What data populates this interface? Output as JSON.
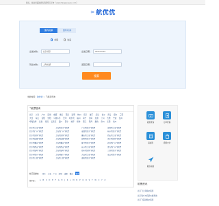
{
  "topbar": {
    "text": "您好，欢迎光临航优优机票预订平台（www.hangyouyou.com）"
  },
  "logo": {
    "text": "航优优"
  },
  "tabs": [
    {
      "label": "国内机票"
    },
    {
      "label": "国际机票"
    }
  ],
  "trip": {
    "oneway": "单程",
    "round": "往返"
  },
  "form": {
    "from_label": "出发城市：",
    "from_value": "北京/南京",
    "date_label": "出发日期：",
    "date_value": "2025-09-29",
    "to_label": "到达城市：",
    "to_value": "上海/虹桥",
    "return_label": "返回日期："
  },
  "search_button": "搜索",
  "breadcrumb": {
    "label": "当前位置：",
    "home": "航优优",
    "sep": ">",
    "current": "飞机票查询"
  },
  "main": {
    "title": "飞机票查询",
    "cities": [
      [
        "北京",
        "上海",
        "广州",
        "深圳",
        "成都",
        "重庆",
        "西安",
        "昆明",
        "杭州",
        "南京",
        "厦门",
        "武汉",
        "长沙",
        "青岛",
        "郑州",
        "三亚"
      ],
      [
        "大连",
        "海口",
        "贵阳",
        "沈阳",
        "乌鲁木齐",
        "天津",
        "哈尔滨",
        "福州",
        "南宁",
        "济南",
        "太原",
        "兰州",
        "合肥",
        "宁波",
        "温州"
      ],
      [
        "呼和浩特",
        "长春",
        "南昌",
        "石家庄",
        "银川",
        "西宁",
        "拉萨",
        "桂林",
        "丽江",
        "珠海",
        "烟台",
        "泉州",
        "无锡",
        "常州"
      ]
    ],
    "routes": [
      [
        "北京到上海飞机票",
        "上海到北京飞机票",
        "广州到北京飞机票",
        "深圳到上海飞机票"
      ],
      [
        "北京到广州飞机票",
        "上海到广州飞机票",
        "成都到北京飞机票",
        "杭州到北京飞机票"
      ],
      [
        "北京到深圳飞机票",
        "上海到深圳飞机票",
        "重庆到上海飞机票",
        "西安到上海飞机票"
      ],
      [
        "北京到成都飞机票",
        "上海到成都飞机票",
        "昆明到北京飞机票",
        "南京到深圳飞机票"
      ],
      [
        "北京到重庆飞机票",
        "上海到重庆飞机票",
        "厦门到北京飞机票",
        "武汉到广州飞机票"
      ],
      [
        "北京到西安飞机票",
        "上海到西安飞机票",
        "长沙到上海飞机票",
        "青岛到广州飞机票"
      ],
      [
        "北京到昆明飞机票",
        "上海到昆明飞机票",
        "郑州到深圳飞机票",
        "三亚到北京飞机票"
      ],
      [
        "北京到杭州飞机票",
        "上海到厦门飞机票",
        "大连到上海飞机票",
        "海口到北京飞机票"
      ],
      [
        "北京到三亚飞机票",
        "上海到三亚飞机票",
        "贵阳到北京飞机票"
      ]
    ],
    "dest": {
      "label": "热门目的地：",
      "items": [
        "北京",
        "上海",
        "广州",
        "深圳",
        "成都",
        "重庆"
      ],
      "more": "更多"
    },
    "letters": {
      "label": "按字母：",
      "items": [
        "A",
        "B",
        "C",
        "D",
        "E",
        "F",
        "G",
        "H",
        "J",
        "K",
        "L",
        "M",
        "N",
        "P",
        "Q",
        "R",
        "S",
        "T",
        "W",
        "X",
        "Y",
        "Z"
      ]
    }
  },
  "side": {
    "tiles": [
      {
        "icon": "ticket-icon",
        "label": "机票查询"
      },
      {
        "icon": "order-icon",
        "label": "订单查询"
      },
      {
        "icon": "note-icon",
        "label": "退改签"
      },
      {
        "icon": "building-icon",
        "label": "机场大全"
      },
      {
        "icon": "plane-icon",
        "label": "航班动态"
      }
    ],
    "title": "机票资讯",
    "links": [
      "北京飞上海特价机票",
      "北京到广州机票价格查询",
      "北京飞深圳特价机票"
    ]
  },
  "colors": {
    "accent": "#2f7de1",
    "button": "#ff8a1f",
    "brand": "#1d63d6"
  }
}
